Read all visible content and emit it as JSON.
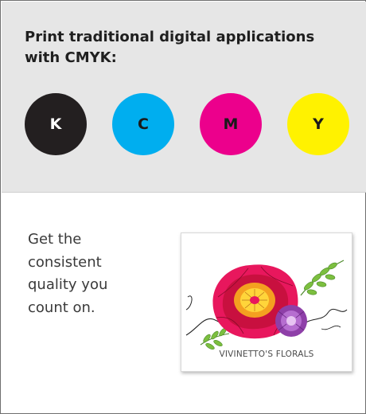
{
  "headline": "Print traditional digital applications with CMYK:",
  "swatches": [
    {
      "letter": "K",
      "color": "#231f20"
    },
    {
      "letter": "C",
      "color": "#00aeef"
    },
    {
      "letter": "M",
      "color": "#ec008c"
    },
    {
      "letter": "Y",
      "color": "#fff200"
    }
  ],
  "copy_lines": [
    "Get the",
    "consistent",
    "quality you",
    "count on."
  ],
  "sample": {
    "brand_text": "VIVINETTO'S FLORALS",
    "image_icon": "floral-logo-print-sample"
  }
}
